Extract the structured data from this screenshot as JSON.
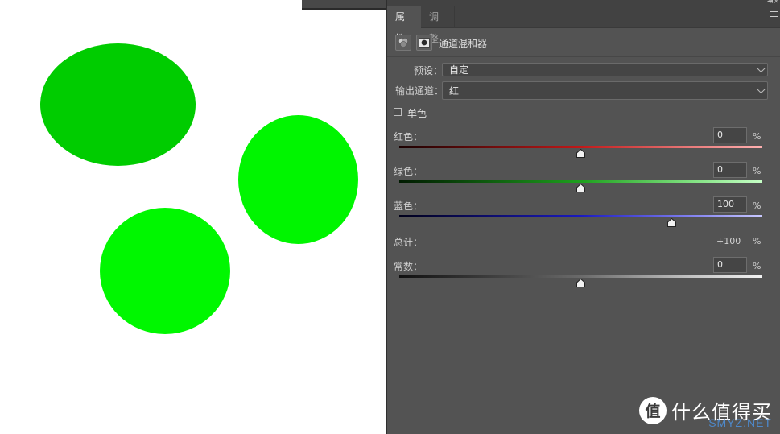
{
  "canvas": {
    "shapes": [
      {
        "color": "#00cc00"
      },
      {
        "color": "#00f500"
      },
      {
        "color": "#00f700"
      }
    ]
  },
  "panel": {
    "tabs": [
      {
        "label": "属性",
        "active": true
      },
      {
        "label": "调整",
        "active": false
      }
    ],
    "header_title": "通道混和器",
    "preset_label": "预设：",
    "preset_value": "自定",
    "output_label": "输出通道：",
    "output_value": "红",
    "mono_label": "单色",
    "mono_checked": false,
    "channels": [
      {
        "label": "红色：",
        "value": "0",
        "unit": "%",
        "slider_fraction": 0.5,
        "color": "#c21818"
      },
      {
        "label": "绿色：",
        "value": "0",
        "unit": "%",
        "slider_fraction": 0.5,
        "color": "#1ea01e"
      },
      {
        "label": "蓝色：",
        "value": "100",
        "unit": "%",
        "slider_fraction": 0.75,
        "color": "#1a1ac0"
      }
    ],
    "total_label": "总计：",
    "total_value": "+100",
    "total_unit": "%",
    "constant": {
      "label": "常数：",
      "value": "0",
      "unit": "%",
      "slider_fraction": 0.5
    }
  },
  "watermark": {
    "logo_char": "值",
    "text": "什么值得买",
    "sub": "SMYZ.NET"
  }
}
